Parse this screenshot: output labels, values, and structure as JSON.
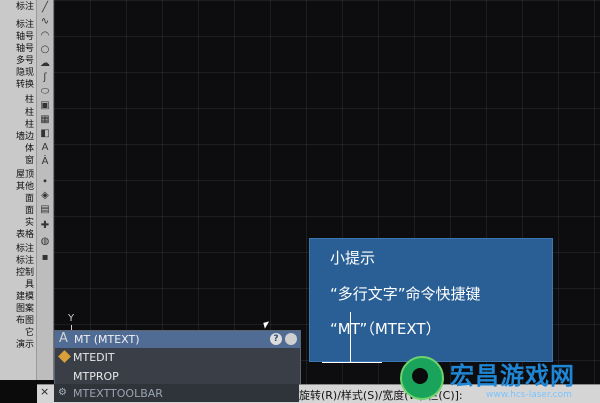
{
  "left_palette": {
    "items": [
      "标注",
      "标注",
      "轴号",
      "轴号",
      "多号",
      "隐现",
      "转换",
      "柱",
      "柱",
      "柱",
      "墙边",
      "体",
      "窗",
      "屋顶",
      "其他",
      "面",
      "面",
      "实",
      "表格",
      "标注",
      "标注",
      "控制",
      "具",
      "建模",
      "图案",
      "布图",
      "它",
      "演示"
    ]
  },
  "tip": {
    "title": "小提示",
    "line1": "“多行文字”命令快捷键",
    "line2": "“MT”（MTEXT）"
  },
  "ucs": {
    "y_label": "Y"
  },
  "autocomplete": {
    "items": [
      {
        "label": "MT (MTEXT)",
        "icon": "text-a-icon"
      },
      {
        "label": "MTEDIT",
        "icon": "edit-icon"
      },
      {
        "label": "MTPROP",
        "icon": "none"
      }
    ],
    "help_label": "?"
  },
  "command_line": {
    "toolbar_label": "MTEXTTOOLBAR",
    "close_label": "×",
    "prompt_text": "旋转(R)/样式(S)/宽度(W)/栏(C)]:"
  },
  "watermark": {
    "text": "宏昌游戏网",
    "url": "www.hcs-laser.com"
  },
  "colors": {
    "tip_bg": "#2a5f96",
    "autocomplete_header": "#506b94",
    "watermark_blue": "#1f86d6",
    "logo_green": "#1aa35a"
  }
}
